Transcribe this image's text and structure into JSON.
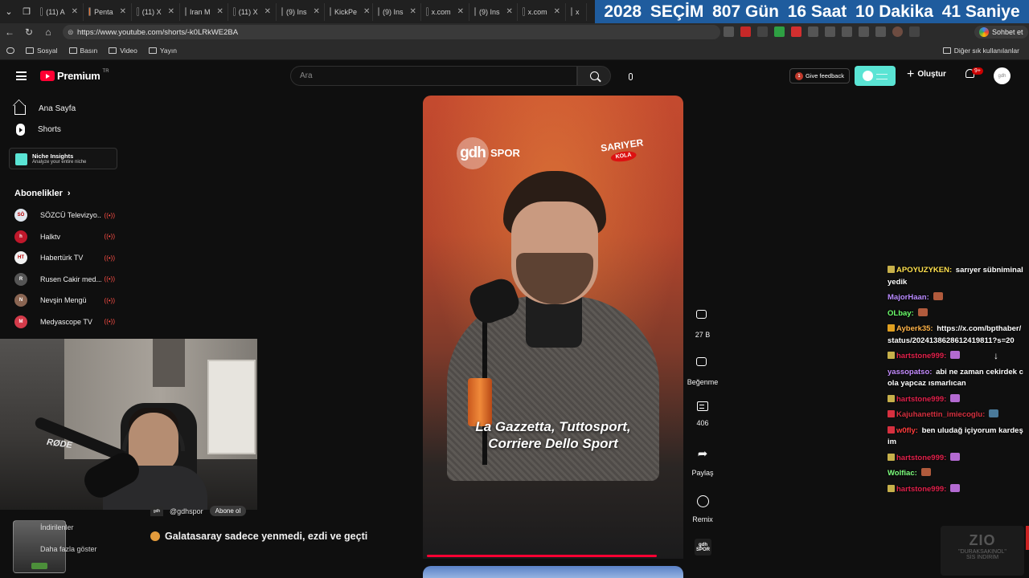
{
  "browser": {
    "tabs": [
      {
        "label": "(11) A",
        "color": "#000000"
      },
      {
        "label": "Penta",
        "color": "#e8702a"
      },
      {
        "label": "(11) X",
        "color": "#000000"
      },
      {
        "label": "Iran M",
        "color": "#000000"
      },
      {
        "label": "(11) X",
        "color": "#000000"
      },
      {
        "label": "(9) Ins",
        "color": "#d62976"
      },
      {
        "label": "KickPe",
        "color": "#b22222"
      },
      {
        "label": "(9) Ins",
        "color": "#d62976"
      },
      {
        "label": "x.com",
        "color": "#000000"
      },
      {
        "label": "(9) Ins",
        "color": "#d62976"
      },
      {
        "label": "x.com",
        "color": "#000000"
      },
      {
        "label": "x",
        "color": "#000000"
      }
    ],
    "banner": {
      "year": "2028",
      "election": "SEÇİM",
      "days": "807 Gün",
      "hours": "16 Saat",
      "minutes": "10 Dakika",
      "seconds": "41 Saniye",
      "color": "#1f5c9e"
    },
    "url": "https://www.youtube.com/shorts/-k0LRkWE2BA",
    "chat_button": "Sohbet et",
    "bookmarks": [
      "Sosyal",
      "Basın",
      "Video",
      "Yayın"
    ],
    "bookmarks_right": "Diğer sık kullanılanlar"
  },
  "yt": {
    "logo_text": "Premium",
    "logo_region": "TR",
    "search_placeholder": "Ara",
    "feedback_label": "Give feedback",
    "create_label": "Oluştur",
    "notif_count": "9+",
    "accent": "#ff0033"
  },
  "sidebar": {
    "home": "Ana Sayfa",
    "shorts": "Shorts",
    "niche_title": "Niche Insights",
    "niche_sub": "Analyze your entire niche",
    "subs_header": "Abonelikler",
    "subs": [
      {
        "name": "SÖZCÜ Televizyo...",
        "color": "#dfe6ee",
        "initial": "SÖZCÜ",
        "live": true
      },
      {
        "name": "Halktv",
        "color": "#c0182b",
        "initial": "h",
        "live": true
      },
      {
        "name": "Habertürk TV",
        "color": "#f2f2f2",
        "initial": "HT",
        "live": true
      },
      {
        "name": "Rusen Cakir med...",
        "color": "#555555",
        "initial": "R",
        "live": true
      },
      {
        "name": "Nevşin Mengü",
        "color": "#8a6552",
        "initial": "N",
        "live": true
      },
      {
        "name": "Medyascope TV",
        "color": "#d43b4a",
        "initial": "M",
        "live": true
      }
    ],
    "downloads": "İndirilenler",
    "show_more": "Daha fazla göster"
  },
  "video": {
    "channel_logo": "gdh",
    "channel_logo_suffix": "SPOR",
    "sponsor": "SARIYER",
    "sponsor_sub": "KOLA",
    "caption_line1": "La Gazzetta, Tuttosport,",
    "caption_line2": "Corriere Dello Sport",
    "channel_handle": "@gdhspor",
    "subscribe": "Abone ol",
    "title": "Galatasaray sadece yenmedi, ezdi ve geçti",
    "channel_thumb": "gdh SPOR"
  },
  "actions": {
    "likes": "27 B",
    "dislike": "Beğenme",
    "comments": "406",
    "share": "Paylaş",
    "remix": "Remix"
  },
  "chat": [
    {
      "user": "APOYUZYKEN:",
      "text": "sarıyer sübniminal yedik",
      "color": "#ffe14d",
      "icon": "#c7b04a"
    },
    {
      "user": "MajorHaan:",
      "text": "",
      "color": "#b98aff",
      "emote": "#b05a3c"
    },
    {
      "user": "OLbay:",
      "text": "",
      "color": "#6bff6b",
      "emote": "#b05a3c"
    },
    {
      "user": "Ayberk35:",
      "text": "https://x.com/bpthaber/status/2024138628612419811?s=20",
      "color": "#ffb347",
      "icon": "#e0a020"
    },
    {
      "user": "hartstone999:",
      "text": "",
      "color": "#e0204a",
      "icon": "#c7b04a",
      "emote": "#b36ad1"
    },
    {
      "user": "yassopatso:",
      "text": "abi ne zaman cekirdek cola yapcaz ısmarlıcan",
      "color": "#c58cff"
    },
    {
      "user": "hartstone999:",
      "text": "",
      "color": "#e0204a",
      "icon": "#c7b04a",
      "emote": "#b36ad1"
    },
    {
      "user": "Kajuhanettin_imiecoglu:",
      "text": "",
      "color": "#d6303f",
      "icon": "#d6303f",
      "emote": "#4a7a9a"
    },
    {
      "user": "w0fly:",
      "text": "ben uludağ içiyorum kardeşim",
      "color": "#ff3c3c",
      "icon": "#d6303f"
    },
    {
      "user": "hartstone999:",
      "text": "",
      "color": "#e0204a",
      "icon": "#c7b04a",
      "emote": "#b36ad1"
    },
    {
      "user": "Wolfiac:",
      "text": "",
      "color": "#7dff7d",
      "emote": "#b05a3c"
    },
    {
      "user": "hartstone999:",
      "text": "",
      "color": "#e0204a",
      "icon": "#c7b04a",
      "emote": "#b36ad1"
    }
  ],
  "watermark": {
    "brand": "ZIO",
    "line": "\"DURAKSAKINOL\"",
    "line2": "SİS İNDİRİM"
  }
}
